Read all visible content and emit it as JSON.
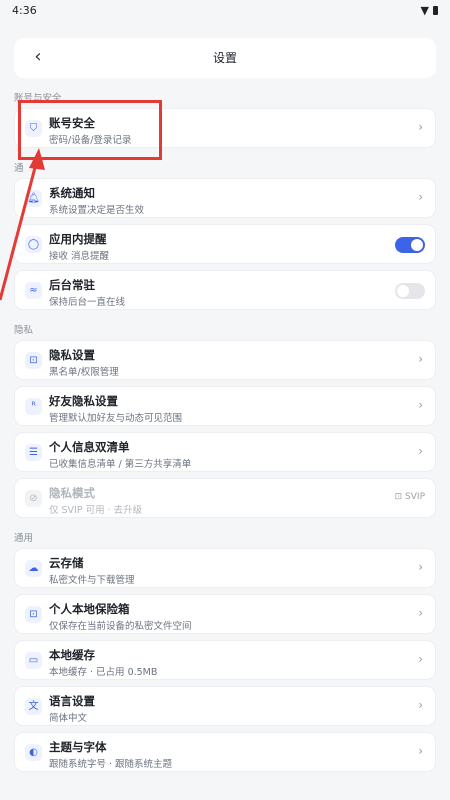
{
  "status_bar": {
    "time": "4:36"
  },
  "header": {
    "back_label": "‹",
    "title": "设置"
  },
  "sections": {
    "account": "账号与安全",
    "notify_partial": "通",
    "privacy": "隐私",
    "general": "通用"
  },
  "items": {
    "account_security": {
      "title": "账号安全",
      "sub": "密码/设备/登录记录"
    },
    "system_notify": {
      "title": "系统通知",
      "sub": "系统设置决定是否生效"
    },
    "in_app_reminder": {
      "title": "应用内提醒",
      "sub": "接收 消息提醒",
      "enabled": true
    },
    "background_resident": {
      "title": "后台常驻",
      "sub": "保持后台一直在线",
      "enabled": false
    },
    "privacy_settings": {
      "title": "隐私设置",
      "sub": "黑名单/权限管理"
    },
    "friend_privacy": {
      "title": "好友隐私设置",
      "sub": "管理默认加好友与动态可见范围"
    },
    "personal_info_lists": {
      "title": "个人信息双清单",
      "sub": "已收集信息清单 / 第三方共享清单"
    },
    "privacy_mode": {
      "title": "隐私模式",
      "sub": "仅 SVIP 可用 · 去升级",
      "badge": "SVIP"
    },
    "cloud_storage": {
      "title": "云存储",
      "sub": "私密文件与下载管理"
    },
    "local_vault": {
      "title": "个人本地保险箱",
      "sub": "仅保存在当前设备的私密文件空间"
    },
    "local_cache": {
      "title": "本地缓存",
      "sub": "本地缓存 · 已占用 0.5MB"
    },
    "language": {
      "title": "语言设置",
      "sub": "简体中文"
    },
    "theme_font": {
      "title": "主题与字体",
      "sub": "跟随系统字号 · 跟随系统主题"
    }
  },
  "icons": {
    "account_security": "shield-icon",
    "system_notify": "bell-icon",
    "in_app_reminder": "chat-bubble-icon",
    "background_resident": "wifi-icon",
    "privacy_settings": "lock-icon",
    "friend_privacy": "user-add-icon",
    "personal_info_lists": "list-icon",
    "privacy_mode": "eye-off-icon",
    "cloud_storage": "cloud-icon",
    "local_vault": "lock-icon",
    "local_cache": "drive-icon",
    "language": "translate-icon",
    "theme_font": "palette-icon"
  },
  "colors": {
    "accent": "#3d64e6",
    "annotation": "#e53935",
    "background": "#f5f6f8"
  }
}
